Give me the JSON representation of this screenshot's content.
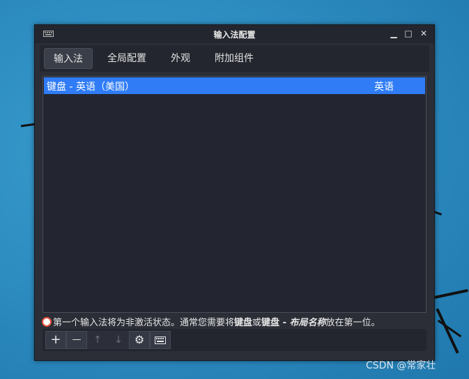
{
  "window": {
    "title": "输入法配置",
    "buttons": {
      "minimize": "▁",
      "maximize": "□",
      "close": "✕"
    }
  },
  "tabs": [
    {
      "label": "输入法",
      "active": true
    },
    {
      "label": "全局配置",
      "active": false
    },
    {
      "label": "外观",
      "active": false
    },
    {
      "label": "附加组件",
      "active": false
    }
  ],
  "input_methods": [
    {
      "name": "键盘 - 英语（美国）",
      "language": "英语",
      "selected": true
    }
  ],
  "warning": {
    "part1": "第一个输入法将为非激活状态。通常您需要将",
    "bold1": "键盘",
    "part2": "或",
    "bold2": "键盘 - ",
    "bold_italic": "布局名称",
    "part3": "放在第一位。"
  },
  "toolbar": {
    "add": "+",
    "remove": "—",
    "up": "↑",
    "down": "↓",
    "configure": "⚙"
  },
  "watermark": "CSDN @常家壮"
}
